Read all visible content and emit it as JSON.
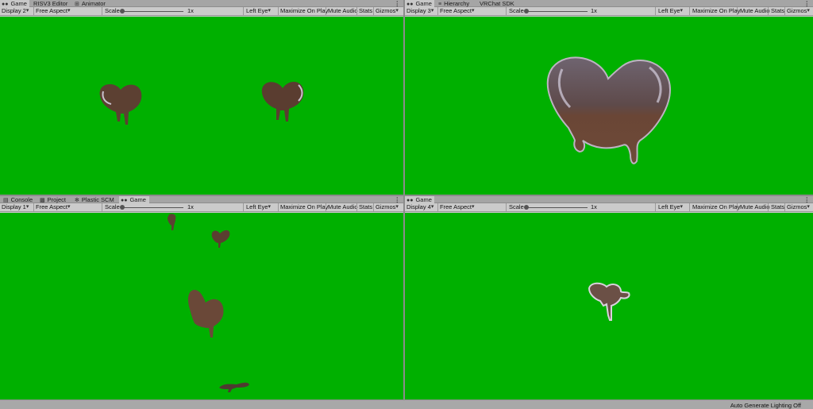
{
  "panels": {
    "top_left": {
      "tabs": [
        {
          "label": "Game",
          "icon": "gamepad-icon",
          "active": true
        },
        {
          "label": "RISV3 Editor",
          "icon": "",
          "active": false
        },
        {
          "label": "Animator",
          "icon": "animator-icon",
          "active": false
        }
      ],
      "display": "Display 2"
    },
    "top_right": {
      "tabs": [
        {
          "label": "Game",
          "icon": "gamepad-icon",
          "active": true
        },
        {
          "label": "Hierarchy",
          "icon": "hierarchy-icon",
          "active": false
        },
        {
          "label": "VRChat SDK",
          "icon": "",
          "active": false
        }
      ],
      "display": "Display 3"
    },
    "bottom_left": {
      "tabs": [
        {
          "label": "Console",
          "icon": "console-icon",
          "active": false
        },
        {
          "label": "Project",
          "icon": "folder-icon",
          "active": false
        },
        {
          "label": "Plastic SCM",
          "icon": "plastic-icon",
          "active": false
        },
        {
          "label": "Game",
          "icon": "gamepad-icon",
          "active": true
        }
      ],
      "display": "Display 1"
    },
    "bottom_right": {
      "tabs": [
        {
          "label": "Game",
          "icon": "gamepad-icon",
          "active": true
        }
      ],
      "display": "Display 4"
    }
  },
  "toolbar": {
    "aspect": "Free Aspect",
    "scale_label": "Scale",
    "scale_value": "1x",
    "eye": "Left Eye",
    "maximize": "Maximize On Play",
    "mute": "Mute Audio",
    "stats": "Stats",
    "gizmos": "Gizmos"
  },
  "status": {
    "lighting": "Auto Generate Lighting Off"
  },
  "colors": {
    "viewport_bg": "#00b000",
    "chocolate": "#6b4a3a",
    "editor_bg": "#c8c8c8"
  }
}
